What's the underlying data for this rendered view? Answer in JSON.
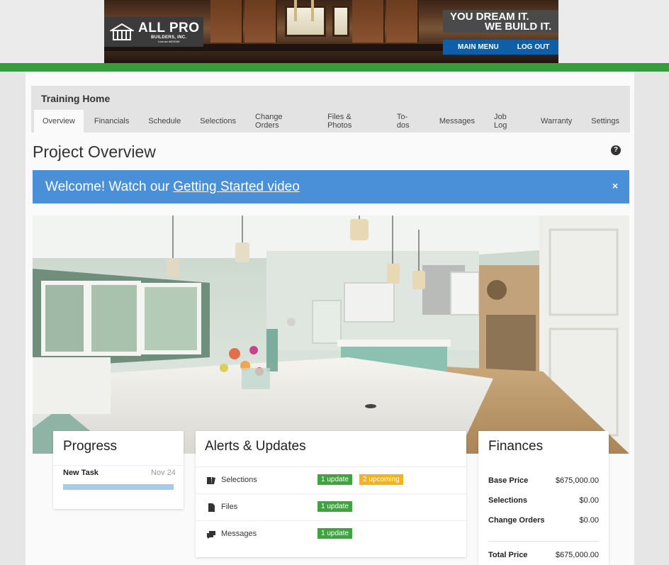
{
  "header": {
    "logo_main": "ALL PRO",
    "logo_sub": "BUILDERS, INC.",
    "logo_license": "License #809158",
    "tagline_line1": "YOU DREAM IT.",
    "tagline_line2": "WE BUILD IT.",
    "nav": [
      {
        "label": "MAIN MENU"
      },
      {
        "label": "LOG OUT"
      }
    ],
    "accent_color": "#3c9a3e",
    "nav_color": "#0f5ea8"
  },
  "project": {
    "name": "Training Home",
    "tabs": [
      {
        "label": "Overview",
        "active": true
      },
      {
        "label": "Financials"
      },
      {
        "label": "Schedule"
      },
      {
        "label": "Selections"
      },
      {
        "label": "Change Orders"
      },
      {
        "label": "Files & Photos"
      },
      {
        "label": "To-dos"
      },
      {
        "label": "Messages"
      },
      {
        "label": "Job Log"
      },
      {
        "label": "Warranty"
      },
      {
        "label": "Settings"
      }
    ]
  },
  "page": {
    "title": "Project Overview",
    "help_glyph": "?"
  },
  "welcome": {
    "text": "Welcome! Watch our",
    "link": "Getting Started video",
    "close": "×",
    "color": "#4a90d9"
  },
  "progress": {
    "title": "Progress",
    "task_name": "New Task",
    "task_date": "Nov 24"
  },
  "alerts": {
    "title": "Alerts & Updates",
    "rows": [
      {
        "label": "Selections",
        "icon": "selections-icon",
        "badges": [
          {
            "text": "1 update",
            "color": "green"
          },
          {
            "text": "2 upcoming",
            "color": "amber"
          }
        ]
      },
      {
        "label": "Files",
        "icon": "file-icon",
        "badges": [
          {
            "text": "1 update",
            "color": "green"
          }
        ]
      },
      {
        "label": "Messages",
        "icon": "messages-icon",
        "badges": [
          {
            "text": "1 update",
            "color": "green"
          }
        ]
      }
    ]
  },
  "finances": {
    "title": "Finances",
    "rows": [
      {
        "label": "Base Price",
        "value": "$675,000.00"
      },
      {
        "label": "Selections",
        "value": "$0.00"
      },
      {
        "label": "Change Orders",
        "value": "$0.00"
      }
    ],
    "total_label": "Total Price",
    "total_value": "$675,000.00"
  }
}
